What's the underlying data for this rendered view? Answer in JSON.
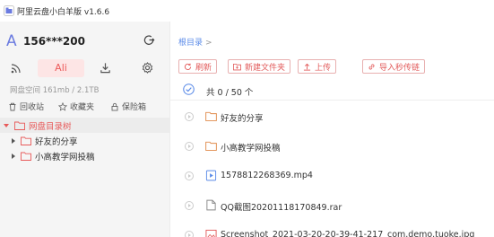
{
  "window": {
    "title": "阿里云盘小白羊版 v1.6.6"
  },
  "account": {
    "avatar_letter": "A",
    "name": "156***200"
  },
  "nav": {
    "ali_label": "Ali"
  },
  "space": {
    "text": "网盘空间 161mb / 2.1TB"
  },
  "quick": [
    {
      "label": "回收站",
      "icon": "trash-icon"
    },
    {
      "label": "收藏夹",
      "icon": "star-icon"
    },
    {
      "label": "保险箱",
      "icon": "lock-icon"
    }
  ],
  "tree": {
    "root": "网盘目录树",
    "children": [
      "好友的分享",
      "小高教学网投稿"
    ]
  },
  "breadcrumb": {
    "root": "根目录",
    "sep": ">"
  },
  "toolbar": {
    "refresh": "刷新",
    "new_folder": "新建文件夹",
    "upload": "上传",
    "import_link": "导入秒传链"
  },
  "list": {
    "count_text": "共 0 / 50 个",
    "items": [
      {
        "name": "好友的分享",
        "type": "folder"
      },
      {
        "name": "小高教学网投稿",
        "type": "folder"
      },
      {
        "name": "1578812268369.mp4",
        "type": "video"
      },
      {
        "name": "QQ截图20201118170849.rar",
        "type": "file"
      },
      {
        "name": "Screenshot_2021-03-20-20-39-41-217_com.demo.tuoke.jpg",
        "type": "image"
      }
    ]
  },
  "colors": {
    "accent": "#e85a5a",
    "link": "#5b8be8",
    "brand": "#6b7be0",
    "sidebar_bg": "#f5f5f5"
  }
}
